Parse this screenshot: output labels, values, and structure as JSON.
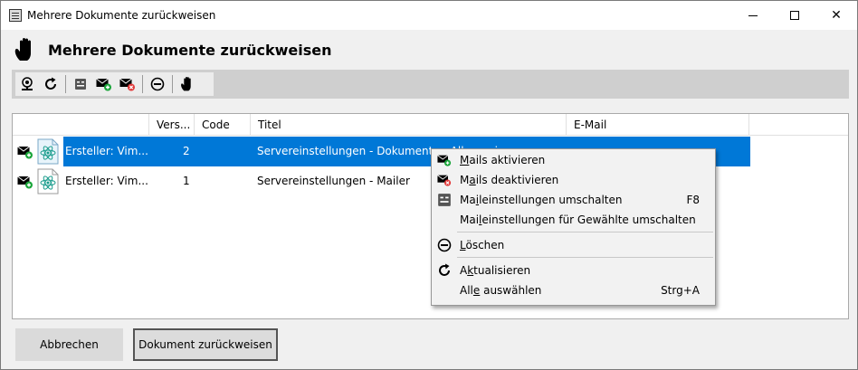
{
  "window": {
    "title": "Mehrere Dokumente zurückweisen",
    "minimize_glyph": "",
    "maximize_glyph": "",
    "close_glyph": "✕"
  },
  "header": {
    "title": "Mehrere Dokumente zurückweisen",
    "icon": "hand-stop-icon"
  },
  "toolbar": {
    "buttons": [
      {
        "name": "webcam-icon"
      },
      {
        "name": "refresh-icon"
      },
      {
        "name": "mail-settings-toggle-icon"
      },
      {
        "name": "mail-activate-icon"
      },
      {
        "name": "mail-deactivate-icon"
      },
      {
        "name": "delete-icon"
      },
      {
        "name": "reject-hand-icon"
      }
    ]
  },
  "grid": {
    "columns": [
      "",
      "Vers...",
      "Code",
      "Titel",
      "E-Mail"
    ],
    "rows": [
      {
        "name": "Ersteller: Vim...",
        "version": "2",
        "code": "",
        "title": "Servereinstellungen - Dokumente - Allgemein",
        "email": "",
        "selected": true
      },
      {
        "name": "Ersteller: Vim...",
        "version": "1",
        "code": "",
        "title": "Servereinstellungen - Mailer",
        "email": "",
        "selected": false
      }
    ]
  },
  "context_menu": {
    "items": [
      {
        "label": "Mails aktivieren",
        "mnemonic": "M",
        "shortcut": "",
        "icon": "mail-activate-icon"
      },
      {
        "label": "Mails deaktivieren",
        "mnemonic": "a",
        "shortcut": "",
        "icon": "mail-deactivate-icon"
      },
      {
        "label": "Maileinstellungen umschalten",
        "mnemonic": "i",
        "shortcut": "F8",
        "icon": "mail-settings-toggle-icon"
      },
      {
        "label": "Maileinstellungen für Gewählte umschalten",
        "mnemonic": "l",
        "shortcut": "",
        "icon": ""
      },
      {
        "label": "Löschen",
        "mnemonic": "L",
        "shortcut": "",
        "icon": "delete-icon"
      },
      {
        "label": "Aktualisieren",
        "mnemonic": "k",
        "shortcut": "",
        "icon": "refresh-icon"
      },
      {
        "label": "Alle auswählen",
        "mnemonic": "e",
        "shortcut": "Strg+A",
        "icon": ""
      }
    ]
  },
  "footer": {
    "cancel_label": "Abbrechen",
    "confirm_label": "Dokument zurückweisen"
  },
  "colors": {
    "selection": "#0078d7",
    "toolbar_bg": "#cfcfcf",
    "window_bg": "#f0f0f0",
    "mail_green": "#1aa53a",
    "mail_red": "#e23b3b"
  }
}
